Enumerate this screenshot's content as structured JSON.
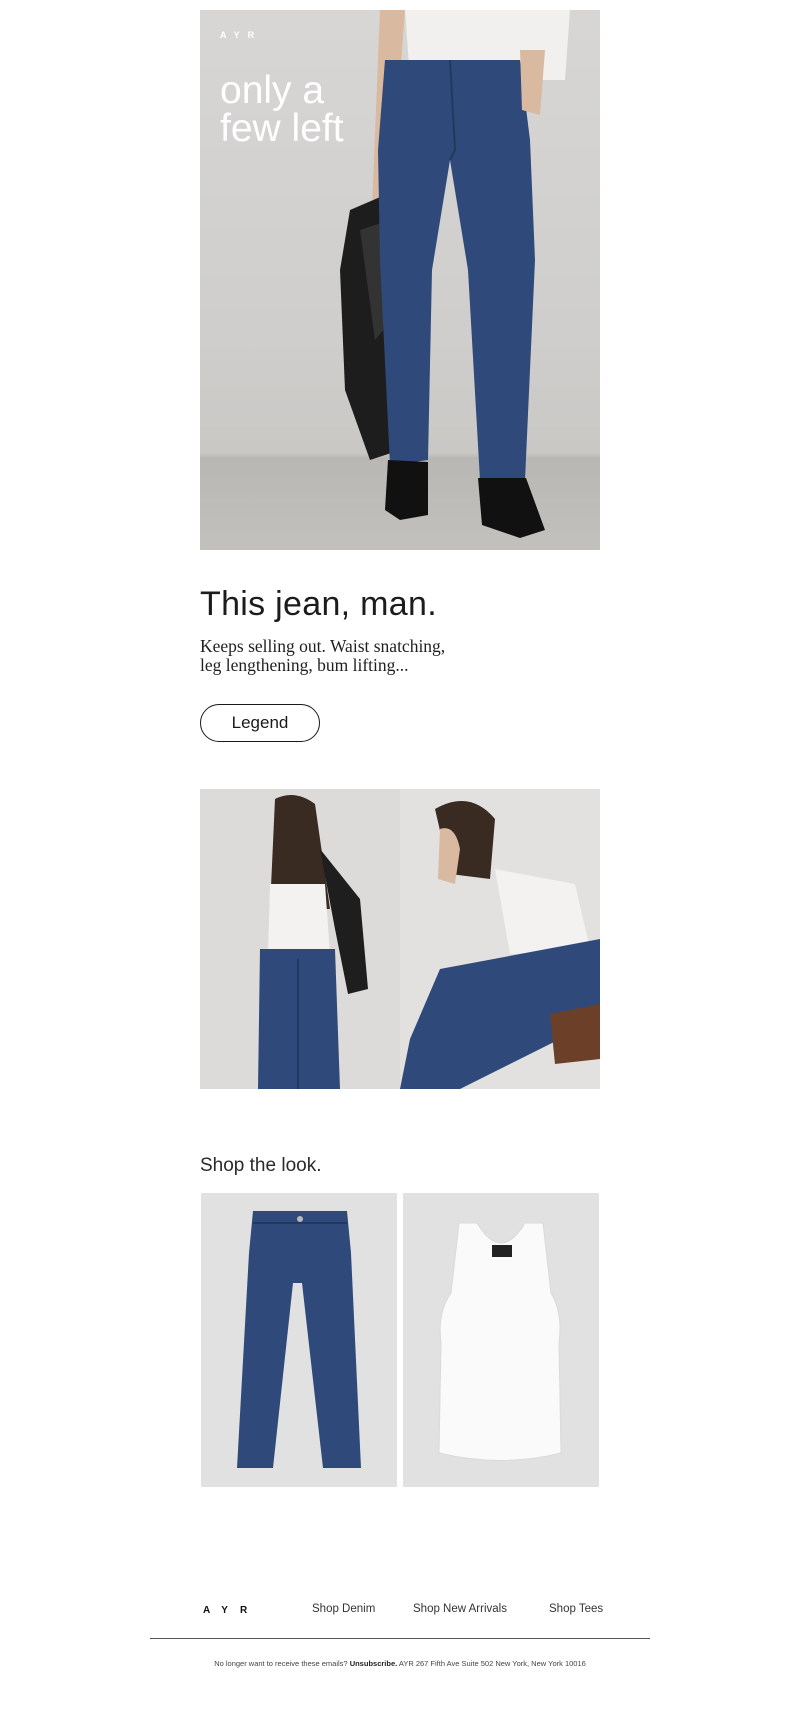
{
  "hero": {
    "logo": "AYR",
    "headline_line1": "only a",
    "headline_line2": "few left"
  },
  "intro": {
    "headline": "This jean, man.",
    "subcopy_line1": "Keeps selling out. Waist snatching,",
    "subcopy_line2": "leg lengthening, bum lifting..."
  },
  "cta": {
    "label": "Legend"
  },
  "shop": {
    "title": "Shop the look."
  },
  "footer": {
    "logo": "AYR",
    "links": [
      "Shop Denim",
      "Shop New Arrivals",
      "Shop Tees"
    ],
    "legal_prefix": "No longer want to receive these emails?",
    "unsubscribe": "Unsubscribe.",
    "address": "AYR 267 Fifth Ave Suite 502 New York, New York 10016"
  },
  "colors": {
    "denim": "#2f4a7a",
    "background": "#ffffff",
    "product_tile": "#e1e1e1",
    "text": "#1a1a1a"
  }
}
